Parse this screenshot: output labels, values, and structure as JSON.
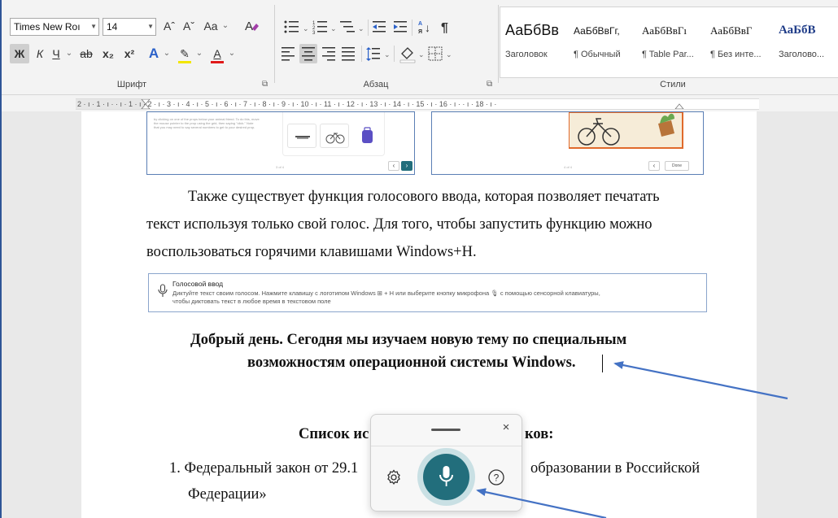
{
  "ribbon": {
    "font": {
      "font_name": "Times New Roı",
      "font_size": "14",
      "grow_label": "Aˆ",
      "shrink_label": "Aˇ",
      "case_label": "Aa",
      "clear_format_label": "A",
      "bold_label": "Ж",
      "italic_label": "К",
      "underline_label": "Ч",
      "strike_label": "ab",
      "subscript_label": "x₂",
      "superscript_label": "x²",
      "text_effects_label": "A",
      "highlight_label": "✎",
      "font_color_label": "A",
      "group_label": "Шрифт"
    },
    "paragraph": {
      "sort_label": "↓",
      "pilcrow_label": "¶",
      "group_label": "Абзац"
    },
    "styles": {
      "group_label": "Стили",
      "items": [
        {
          "sample": "АаБбВв",
          "name": "Заголовок"
        },
        {
          "sample": "АаБбВвГг,",
          "name": "¶ Обычный"
        },
        {
          "sample": "АаБбВвГı",
          "name": "¶ Table Par..."
        },
        {
          "sample": "АаБбВвГ",
          "name": "¶ Без инте..."
        },
        {
          "sample": "АаБбВ",
          "name": "Заголово..."
        }
      ]
    }
  },
  "ruler": {
    "labels": "2 · ı · 1 · ı ·     · ı · 1 · ı · 2 · ı · 3 · ı · 4 · ı · 5 · ı · 6 · ı · 7 · ı · 8 · ı · 9 · ı · 10 · ı · 11 · ı · 12 · ı · 13 · ı · 14 · ı · 15 · ı · 16 · ı ·     · ı · 18 · ı ·"
  },
  "document": {
    "embedded_left": {
      "fine_text": "by clicking on one of the props below your animal friend. To do this, move the mouse pointer to the prop using the grid, then saying \"click.\" Note that you may need to say several numbers to get to your desired prop.",
      "page_indicator": "3 of 4",
      "prev_label": "‹",
      "next_label": "›"
    },
    "embedded_right": {
      "page_indicator": "4 of 4",
      "prev_label": "‹",
      "done_label": "Done"
    },
    "para1_line1": "Также существует функция голосового ввода, которая позволяет печатать",
    "para1_line2": "текст используя только свой голос. Для того, чтобы запустить функцию можно",
    "para1_line3": "воспользоваться горячими клавишами Windows+H.",
    "voice_banner": {
      "title": "Голосовой ввод",
      "line1": "Диктуйте текст своим голосом. Нажмите клавишу с логотипом Windows ⊞ + H или выберите кнопку микрофона 🎙 с помощью сенсорной клавиатуры,",
      "line2": "чтобы диктовать текст в любое время в текстовом поле"
    },
    "heading_line1": "Добрый день. Сегодня мы изучаем новую тему по специальным",
    "heading_line2": "возможностям операционной системы Windows.",
    "refs_heading_left": "Список ис",
    "refs_heading_right": "ков:",
    "list_item_line1_left": "1.  Федеральный закон от 29.1",
    "list_item_line1_right": "образовании в Российской",
    "list_item_line2": "Федерации»"
  },
  "voice_popup": {
    "close_label": "×",
    "help_label": "?"
  },
  "colors": {
    "accent_teal": "#226e7c",
    "arrow_blue": "#4472c4",
    "frame_blue": "#2f5597"
  }
}
